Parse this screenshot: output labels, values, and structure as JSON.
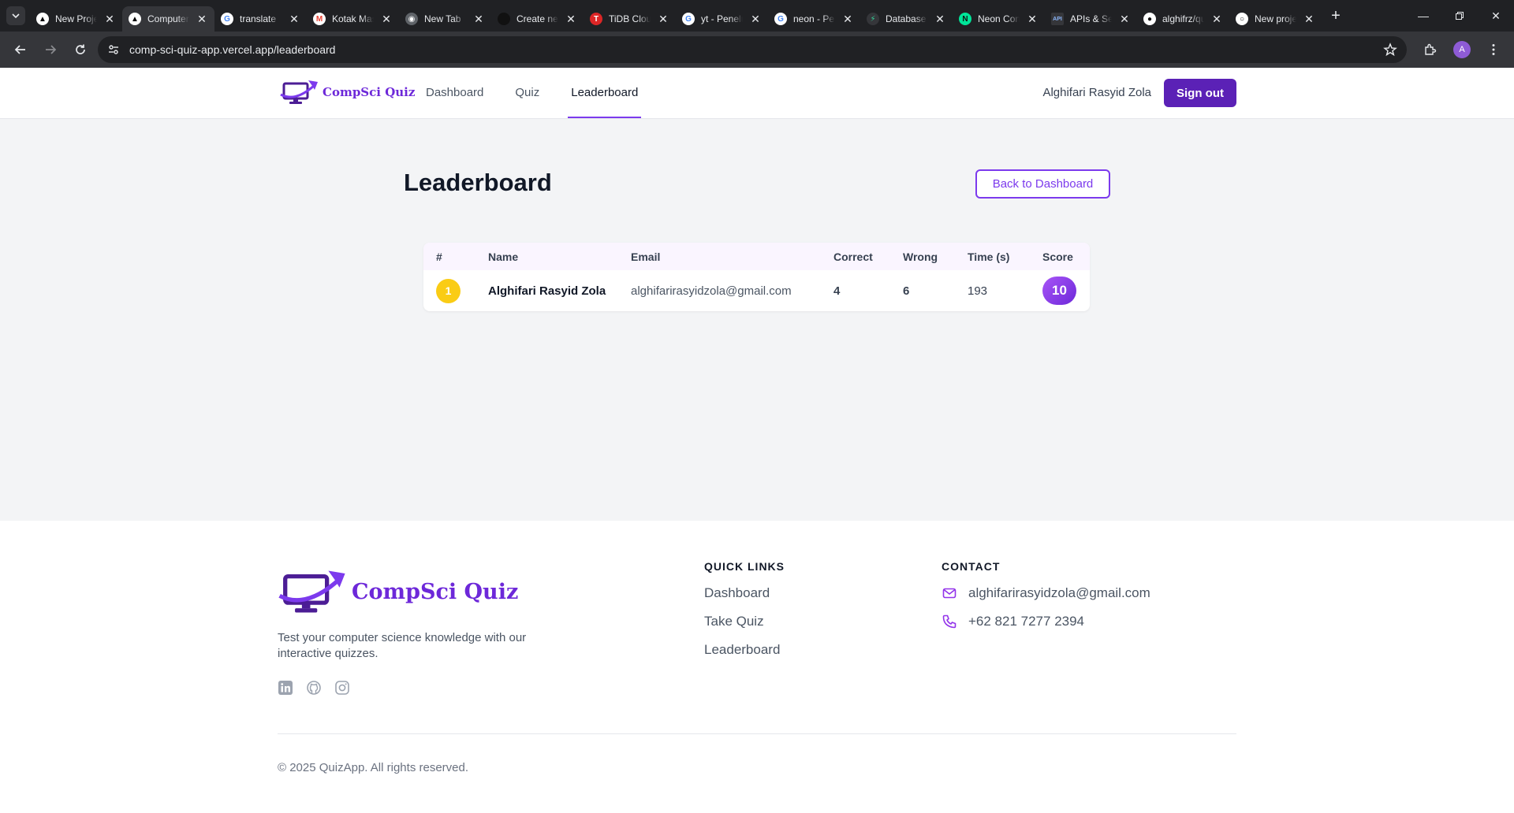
{
  "browser": {
    "tabs": [
      {
        "title": "New Project",
        "icon": "triangle-icon",
        "active": false
      },
      {
        "title": "Computer Science Quiz",
        "icon": "triangle-icon",
        "active": true
      },
      {
        "title": "translate",
        "icon": "google-icon",
        "active": false
      },
      {
        "title": "Kotak Masuk",
        "icon": "gmail-icon",
        "active": false
      },
      {
        "title": "New Tab",
        "icon": "chrome-icon",
        "active": false
      },
      {
        "title": "Create new",
        "icon": "dark-circle-icon",
        "active": false
      },
      {
        "title": "TiDB Cloud",
        "icon": "tidb-icon",
        "active": false
      },
      {
        "title": "yt - Penelusuran",
        "icon": "google-icon",
        "active": false
      },
      {
        "title": "neon - Penelusuran",
        "icon": "google-icon",
        "active": false
      },
      {
        "title": "Database",
        "icon": "bolt-icon",
        "active": false
      },
      {
        "title": "Neon Console",
        "icon": "neon-icon",
        "active": false
      },
      {
        "title": "APIs & Services",
        "icon": "api-icon",
        "active": false
      },
      {
        "title": "alghifrz/quiz",
        "icon": "github-icon",
        "active": false
      },
      {
        "title": "New project",
        "icon": "circle-icon",
        "active": false
      }
    ],
    "url": "comp-sci-quiz-app.vercel.app/leaderboard",
    "profile_initial": "A"
  },
  "header": {
    "brand": "CompSci Quiz",
    "nav": [
      "Dashboard",
      "Quiz",
      "Leaderboard"
    ],
    "active_nav": "Leaderboard",
    "user_name": "Alghifari Rasyid Zola",
    "sign_out": "Sign out",
    "accent_color": "#5b21b6"
  },
  "main": {
    "title": "Leaderboard",
    "back_button": "Back to Dashboard",
    "table": {
      "columns": [
        "#",
        "Name",
        "Email",
        "Correct",
        "Wrong",
        "Time (s)",
        "Score"
      ],
      "rows": [
        {
          "rank": "1",
          "name": "Alghifari Rasyid Zola",
          "email": "alghifarirasyidzola@gmail.com",
          "correct": "4",
          "wrong": "6",
          "time": "193",
          "score": "10"
        }
      ]
    }
  },
  "footer": {
    "brand": "CompSci Quiz",
    "tagline": "Test your computer science knowledge with our interactive quizzes.",
    "social": [
      "linkedin-icon",
      "github-icon",
      "instagram-icon"
    ],
    "quick_links_title": "QUICK LINKS",
    "quick_links": [
      "Dashboard",
      "Take Quiz",
      "Leaderboard"
    ],
    "contact_title": "CONTACT",
    "email": "alghifarirasyidzola@gmail.com",
    "phone": "+62 821 7277 2394",
    "copyright": "© 2025 QuizApp. All rights reserved."
  }
}
